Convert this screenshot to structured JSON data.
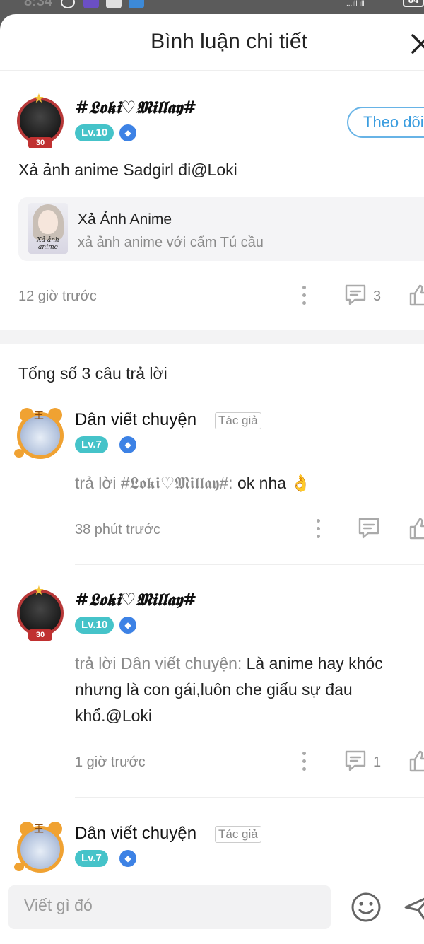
{
  "status_bar": {
    "time": "8:34",
    "signal": "...ıll ıll",
    "battery": "84"
  },
  "header": {
    "title": "Bình luận chi tiết",
    "close_icon": "close-icon"
  },
  "post": {
    "username": "#𝕷𝖔𝖐𝖎♡𝕸𝖎𝖑𝖑𝖆𝖞#",
    "level": "Lv.10",
    "avatar_tag": "30",
    "follow_label": "Theo dõi",
    "text": "Xả ảnh anime Sadgirl đi@Loki",
    "card": {
      "title": "Xả Ảnh Anime",
      "subtitle": "xả ảnh anime với cẩm Tú cầu",
      "thumb_caption": "Xả ảnh anime"
    },
    "time": "12 giờ trước",
    "comment_count": "3"
  },
  "replies_total": "Tổng số 3 câu trả lời",
  "replies": [
    {
      "username": "Dân viết chuyện",
      "author_badge": "Tác giả",
      "level": "Lv.7",
      "reply_prefix": "trả lời #𝕷𝖔𝖐𝖎♡𝕸𝖎𝖑𝖑𝖆𝖞#:",
      "text": "ok nha 👌",
      "time": "38 phút trước"
    },
    {
      "username": "#𝕷𝖔𝖐𝖎♡𝕸𝖎𝖑𝖑𝖆𝖞#",
      "level": "Lv.10",
      "avatar_tag": "30",
      "reply_prefix": "trả lời Dân viết chuyện:",
      "text_line1": "Là anime hay khóc",
      "text_line2": "nhưng là con gái,luôn che giấu sự đau",
      "text_line3": "khổ.@Loki",
      "time": "1 giờ trước",
      "comment_count": "1"
    },
    {
      "username": "Dân viết chuyện",
      "author_badge": "Tác giả",
      "level": "Lv.7"
    }
  ],
  "composer": {
    "placeholder": "Viết gì đó"
  },
  "colors": {
    "level_badge": "#45c3c9",
    "follow_accent": "#3b9ddf",
    "shield": "#3d82e5",
    "avatar_ring_tiger": "#f0a232"
  }
}
